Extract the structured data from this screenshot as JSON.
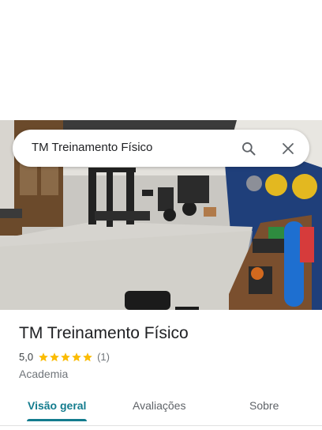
{
  "search": {
    "query": "TM Treinamento Físico"
  },
  "place": {
    "title": "TM Treinamento Físico",
    "rating": "5,0",
    "stars": 5,
    "review_count": "(1)",
    "category": "Academia"
  },
  "tabs": [
    {
      "label": "Visão geral",
      "active": true
    },
    {
      "label": "Avaliações",
      "active": false
    },
    {
      "label": "Sobre",
      "active": false
    }
  ],
  "colors": {
    "accent": "#137c8e",
    "star": "#fbbc04"
  },
  "icons": {
    "search": "search-icon",
    "close": "close-icon"
  }
}
